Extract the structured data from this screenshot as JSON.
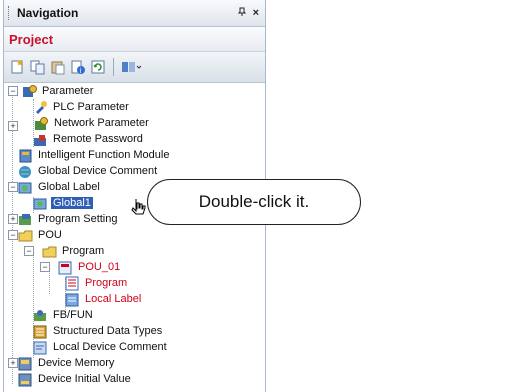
{
  "panel": {
    "title": "Navigation",
    "pin_icon": "pin-icon",
    "close_label": "×",
    "pin_label": "ꟸ"
  },
  "project": {
    "label": "Project"
  },
  "toolbar": {
    "icons": [
      "new-data-icon",
      "copy-icon",
      "paste-icon",
      "properties-icon",
      "refresh-icon",
      "layout-icon"
    ]
  },
  "tree": {
    "parameter": "Parameter",
    "plc_parameter": "PLC Parameter",
    "network_parameter": "Network Parameter",
    "remote_password": "Remote Password",
    "intelligent_function_module": "Intelligent Function Module",
    "global_device_comment": "Global Device Comment",
    "global_label": "Global Label",
    "global1": "Global1",
    "program_setting": "Program Setting",
    "pou": "POU",
    "program": "Program",
    "pou_01": "POU_01",
    "pou01_program": "Program",
    "local_label": "Local Label",
    "fb_fun": "FB/FUN",
    "structured_data_types": "Structured Data Types",
    "local_device_comment": "Local Device Comment",
    "device_memory": "Device Memory",
    "device_initial_value": "Device Initial Value"
  },
  "callout": {
    "text": "Double-click it."
  },
  "colors": {
    "accent_red": "#d0021b",
    "selection": "#2f5eb5"
  }
}
